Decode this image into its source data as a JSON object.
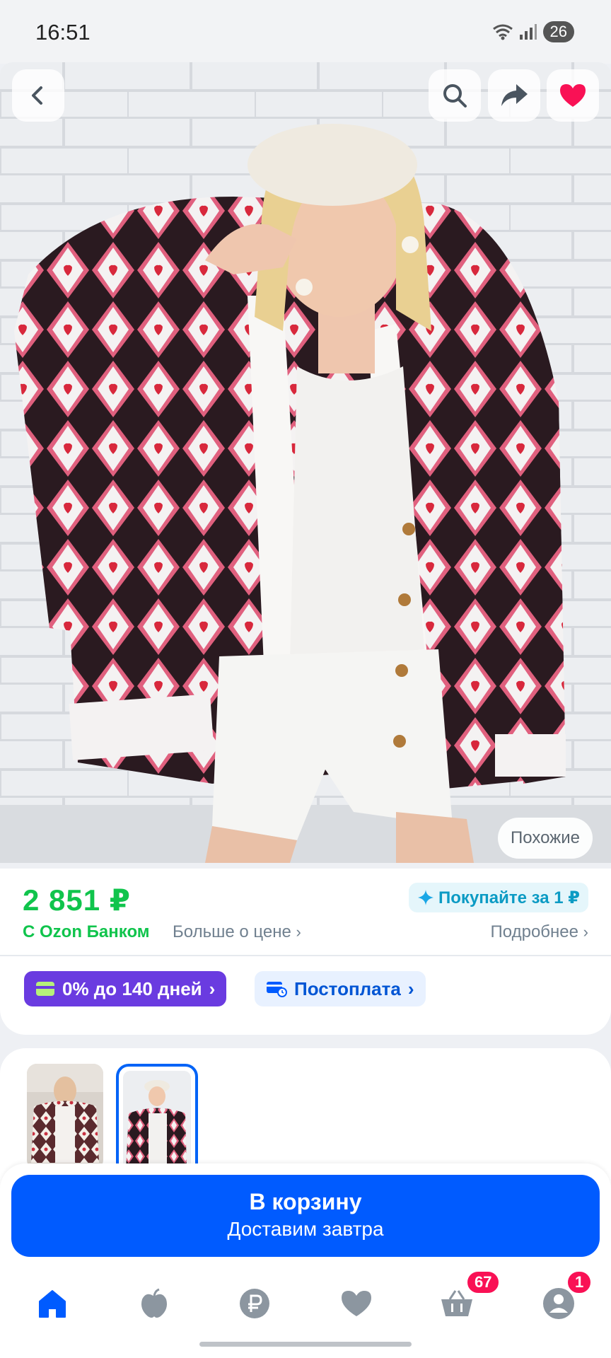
{
  "status_bar": {
    "time": "16:51",
    "battery": "26"
  },
  "hero": {
    "back_icon": "chevron-left-icon",
    "search_icon": "search-icon",
    "share_icon": "share-icon",
    "favorite_icon": "heart-filled-icon",
    "similar_label": "Похожие"
  },
  "price_block": {
    "price": "2 851 ₽",
    "bank_label": "С Ozon Банком",
    "more_about_price": "Больше о цене",
    "buy_for_one": "Покупайте за 1 ₽",
    "details": "Подробнее"
  },
  "payment_pills": {
    "installment": "0% до 140 дней",
    "postpay": "Постоплата"
  },
  "cart": {
    "title": "В корзину",
    "subtitle": "Доставим завтра"
  },
  "bottom_nav": {
    "cart_badge": "67",
    "profile_badge": "1"
  },
  "colors": {
    "price_green": "#10c44c",
    "primary_blue": "#005bff",
    "favorite_pink": "#f91155",
    "installment_purple": "#6a3be0"
  }
}
